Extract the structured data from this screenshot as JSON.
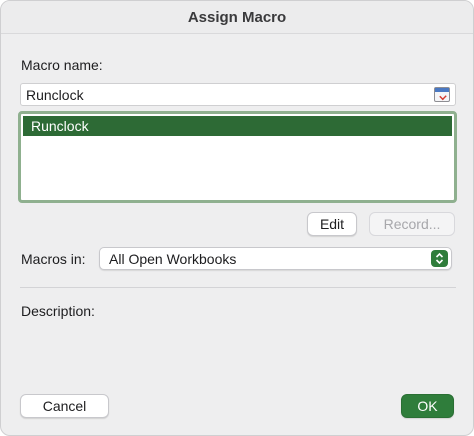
{
  "dialog": {
    "title": "Assign Macro",
    "macro_name_label": "Macro name:",
    "macro_name_value": "Runclock",
    "macro_list": [
      {
        "label": "Runclock",
        "selected": true
      }
    ],
    "edit_label": "Edit",
    "record_label": "Record...",
    "macros_in_label": "Macros in:",
    "macros_in_value": "All Open Workbooks",
    "description_label": "Description:",
    "cancel_label": "Cancel",
    "ok_label": "OK"
  },
  "icons": {
    "collapse": "collapse-dialog-icon",
    "stepper": "chevron-up-down-icon"
  },
  "colors": {
    "accent": "#2f7d3b",
    "selection": "#2d6a35",
    "list_border": "#8fb08f"
  }
}
